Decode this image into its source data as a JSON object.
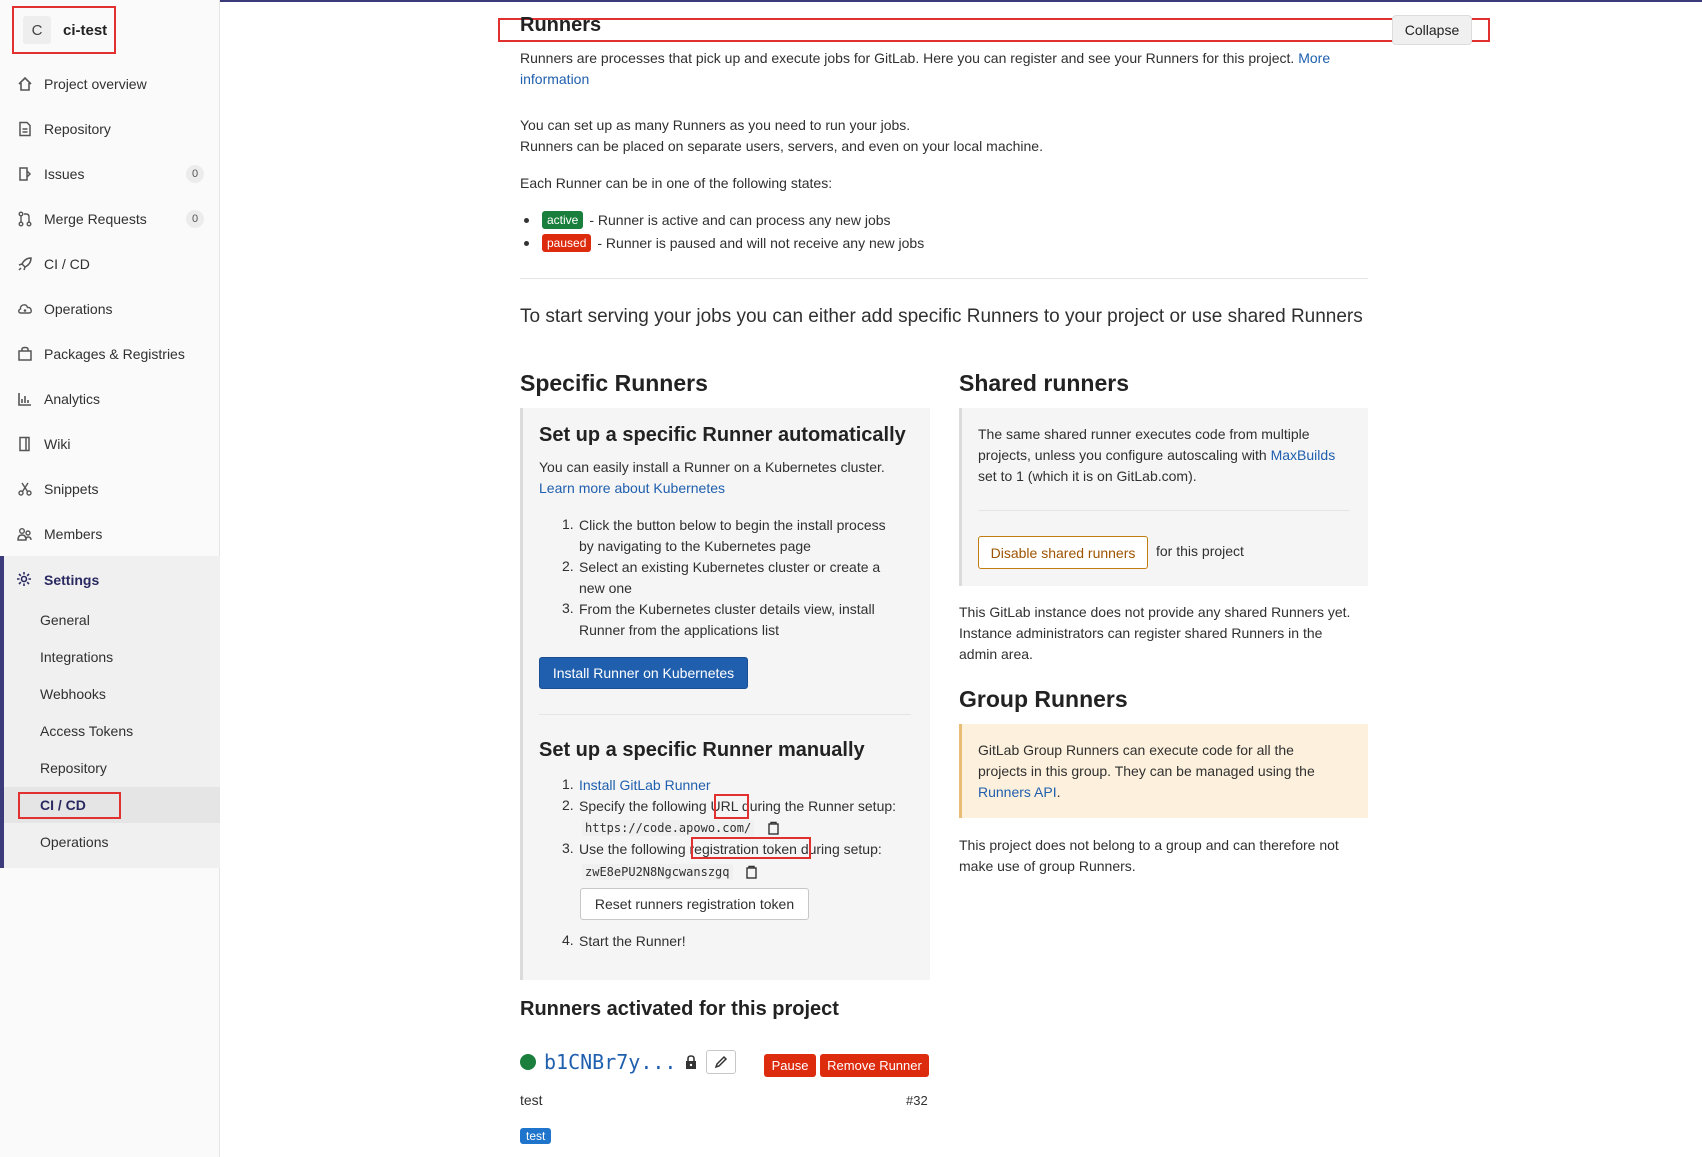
{
  "project": {
    "avatar_letter": "C",
    "name": "ci-test"
  },
  "sidebar": {
    "items": [
      {
        "label": "Project overview",
        "icon": "home-icon"
      },
      {
        "label": "Repository",
        "icon": "document-icon"
      },
      {
        "label": "Issues",
        "icon": "issues-icon",
        "count": "0"
      },
      {
        "label": "Merge Requests",
        "icon": "merge-request-icon",
        "count": "0"
      },
      {
        "label": "CI / CD",
        "icon": "rocket-icon"
      },
      {
        "label": "Operations",
        "icon": "cloud-gear-icon"
      },
      {
        "label": "Packages & Registries",
        "icon": "package-icon"
      },
      {
        "label": "Analytics",
        "icon": "chart-icon"
      },
      {
        "label": "Wiki",
        "icon": "book-icon"
      },
      {
        "label": "Snippets",
        "icon": "scissors-icon"
      },
      {
        "label": "Members",
        "icon": "users-icon"
      }
    ],
    "settings": {
      "label": "Settings",
      "sub": [
        "General",
        "Integrations",
        "Webhooks",
        "Access Tokens",
        "Repository",
        "CI / CD",
        "Operations"
      ]
    }
  },
  "runners": {
    "title": "Runners",
    "collapse": "Collapse",
    "intro": "Runners are processes that pick up and execute jobs for GitLab. Here you can register and see your Runners for this project.",
    "more_1": "More",
    "more_2": "information",
    "line1": "You can set up as many Runners as you need to run your jobs.",
    "line2": "Runners can be placed on separate users, servers, and even on your local machine.",
    "states_intro": "Each Runner can be in one of the following states:",
    "state_active": "active",
    "state_active_text": "- Runner is active and can process any new jobs",
    "state_paused": "paused",
    "state_paused_text": "- Runner is paused and will not receive any new jobs",
    "lead": "To start serving your jobs you can either add specific Runners to your project or use shared Runners"
  },
  "specific": {
    "title": "Specific Runners",
    "auto_title": "Set up a specific Runner automatically",
    "auto_desc": "You can easily install a Runner on a Kubernetes cluster.",
    "auto_link": "Learn more about Kubernetes",
    "steps": [
      "Click the button below to begin the install process",
      "by navigating to the Kubernetes page",
      "Select an existing Kubernetes cluster or create a",
      "new one",
      "From the Kubernetes cluster details view, install",
      "Runner from the applications list"
    ],
    "install_btn": "Install Runner on Kubernetes",
    "manual_title": "Set up a specific Runner manually",
    "m1_link": "Install GitLab Runner",
    "m2_pre": "Specify the following",
    "m2_hl": "URL",
    "m2_post": "during the Runner setup:",
    "url": "https://code.apowo.com/",
    "m3_pre": "Use the following",
    "m3_hl": "registration token",
    "m3_post": "during setup:",
    "token": "zwE8ePU2N8Ngcwanszgq",
    "reset_btn": "Reset runners registration token",
    "m4": "Start the Runner!"
  },
  "shared": {
    "title": "Shared runners",
    "desc_1": "The same shared runner executes code from multiple",
    "desc_2": "projects, unless you configure autoscaling with",
    "desc_link": "MaxBuilds",
    "desc_3": "set to 1 (which it is on GitLab.com).",
    "disable_btn": "Disable shared runners",
    "for_project": "for this project",
    "note_1": "This GitLab instance does not provide any shared Runners yet.",
    "note_2": "Instance administrators can register shared Runners in the",
    "note_3": "admin area."
  },
  "group": {
    "title": "Group Runners",
    "desc_1": "GitLab Group Runners can execute code for all the",
    "desc_2": "projects in this group. They can be managed using the",
    "desc_link": "Runners API",
    "desc_end": ".",
    "note_1": "This project does not belong to a group and can therefore not",
    "note_2": "make use of group Runners."
  },
  "activated": {
    "title": "Runners activated for this project",
    "runner_id": "b1CNBr7y...",
    "pause_btn": "Pause",
    "remove_btn": "Remove Runner",
    "description": "test",
    "number": "#32",
    "tag": "test"
  },
  "colors": {
    "accent": "#1f5fae",
    "success": "#1a7f3c",
    "danger": "#dd2b0e",
    "highlight": "#e03030",
    "nav_active": "#292961"
  }
}
